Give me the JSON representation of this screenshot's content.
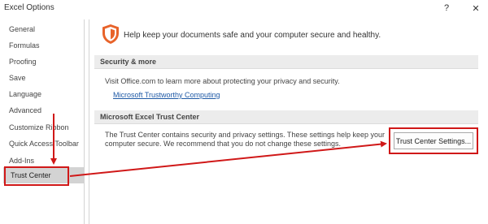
{
  "window": {
    "title": "Excel Options",
    "help_label": "?",
    "close_label": "✕"
  },
  "sidebar": {
    "items": [
      {
        "label": "General"
      },
      {
        "label": "Formulas"
      },
      {
        "label": "Proofing"
      },
      {
        "label": "Save"
      },
      {
        "label": "Language"
      },
      {
        "label": "Advanced"
      },
      {
        "label": "Customize Ribbon"
      },
      {
        "label": "Quick Access Toolbar"
      },
      {
        "label": "Add-Ins"
      },
      {
        "label": "Trust Center",
        "selected": true
      }
    ]
  },
  "main": {
    "headline": "Help keep your documents safe and your computer secure and healthy.",
    "headline_icon": "shield-icon",
    "security": {
      "title": "Security & more",
      "text": "Visit Office.com to learn more about protecting your privacy and security.",
      "link": "Microsoft Trustworthy Computing"
    },
    "trust_center": {
      "title": "Microsoft Excel Trust Center",
      "text_line1": "The Trust Center contains security and privacy settings. These settings help keep your",
      "text_line2": "computer secure. We recommend that you do not change these settings.",
      "button_label": "Trust Center Settings..."
    }
  },
  "colors": {
    "annotation": "#d01818",
    "selected_bg": "#d3d3d3",
    "link": "#1f5aa6",
    "shield": "#e8632a"
  }
}
